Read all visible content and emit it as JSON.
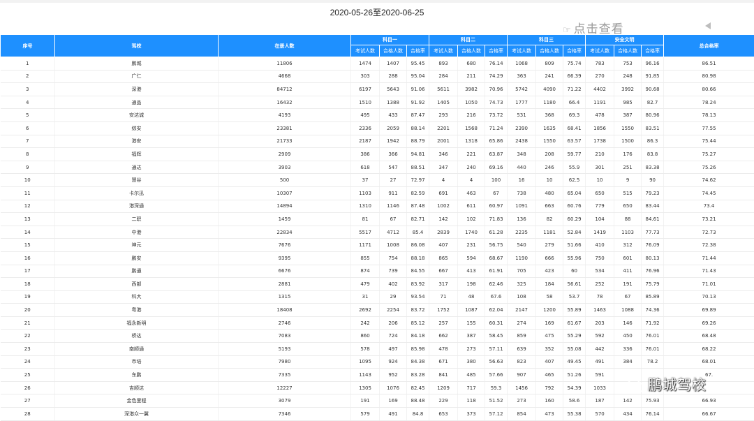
{
  "date_range": "2020-05-26至2020-06-25",
  "view_link": "点击查看",
  "watermark": "鹏城驾校",
  "headers": {
    "no": "序号",
    "school": "驾校",
    "enrolled": "在册人数",
    "subject1": "科目一",
    "subject2": "科目二",
    "subject3": "科目三",
    "safety": "安全文明",
    "total_rate": "总合格率",
    "examinees": "考试人数",
    "passed": "合格人数",
    "rate": "合格率"
  },
  "rows": [
    [
      "1",
      "鹏城",
      "11806",
      "1474",
      "1407",
      "95.45",
      "893",
      "680",
      "76.14",
      "1068",
      "809",
      "75.74",
      "783",
      "753",
      "96.16",
      "86.51"
    ],
    [
      "2",
      "广仁",
      "4668",
      "303",
      "288",
      "95.04",
      "284",
      "211",
      "74.29",
      "363",
      "241",
      "66.39",
      "270",
      "248",
      "91.85",
      "80.98"
    ],
    [
      "3",
      "深港",
      "84712",
      "6197",
      "5643",
      "91.06",
      "5611",
      "3982",
      "70.96",
      "5742",
      "4090",
      "71.22",
      "4402",
      "3992",
      "90.68",
      "80.66"
    ],
    [
      "4",
      "通品",
      "16432",
      "1510",
      "1388",
      "91.92",
      "1405",
      "1050",
      "74.73",
      "1777",
      "1180",
      "66.4",
      "1191",
      "985",
      "82.7",
      "78.24"
    ],
    [
      "5",
      "安达诚",
      "4193",
      "495",
      "433",
      "87.47",
      "293",
      "216",
      "73.72",
      "531",
      "368",
      "69.3",
      "478",
      "387",
      "80.96",
      "78.13"
    ],
    [
      "6",
      "综安",
      "23381",
      "2336",
      "2059",
      "88.14",
      "2201",
      "1568",
      "71.24",
      "2390",
      "1635",
      "68.41",
      "1856",
      "1550",
      "83.51",
      "77.55"
    ],
    [
      "7",
      "港安",
      "21733",
      "2187",
      "1942",
      "88.79",
      "2001",
      "1318",
      "65.86",
      "2438",
      "1550",
      "63.57",
      "1738",
      "1500",
      "86.3",
      "75.44"
    ],
    [
      "8",
      "福辉",
      "2909",
      "386",
      "366",
      "94.81",
      "346",
      "221",
      "63.87",
      "348",
      "208",
      "59.77",
      "210",
      "176",
      "83.8",
      "75.27"
    ],
    [
      "9",
      "通达",
      "3903",
      "618",
      "547",
      "88.51",
      "347",
      "240",
      "69.16",
      "440",
      "246",
      "55.9",
      "301",
      "251",
      "83.38",
      "75.26"
    ],
    [
      "10",
      "慧谷",
      "500",
      "37",
      "27",
      "72.97",
      "4",
      "4",
      "100",
      "16",
      "10",
      "62.5",
      "10",
      "9",
      "90",
      "74.62"
    ],
    [
      "11",
      "卡尔迅",
      "10307",
      "1103",
      "911",
      "82.59",
      "691",
      "463",
      "67",
      "738",
      "480",
      "65.04",
      "650",
      "515",
      "79.23",
      "74.45"
    ],
    [
      "12",
      "港深通",
      "14894",
      "1310",
      "1146",
      "87.48",
      "1002",
      "611",
      "60.97",
      "1091",
      "663",
      "60.76",
      "779",
      "650",
      "83.44",
      "73.4"
    ],
    [
      "13",
      "二职",
      "1459",
      "81",
      "67",
      "82.71",
      "142",
      "102",
      "71.83",
      "136",
      "82",
      "60.29",
      "104",
      "88",
      "84.61",
      "73.21"
    ],
    [
      "14",
      "中港",
      "22834",
      "5517",
      "4712",
      "85.4",
      "2839",
      "1740",
      "61.28",
      "2235",
      "1181",
      "52.84",
      "1419",
      "1103",
      "77.73",
      "72.73"
    ],
    [
      "15",
      "坤元",
      "7676",
      "1171",
      "1008",
      "86.08",
      "407",
      "231",
      "56.75",
      "540",
      "279",
      "51.66",
      "410",
      "312",
      "76.09",
      "72.38"
    ],
    [
      "16",
      "鹏安",
      "9395",
      "855",
      "754",
      "88.18",
      "865",
      "594",
      "68.67",
      "1190",
      "666",
      "55.96",
      "750",
      "601",
      "80.13",
      "71.44"
    ],
    [
      "17",
      "鹏通",
      "6676",
      "874",
      "739",
      "84.55",
      "667",
      "413",
      "61.91",
      "705",
      "423",
      "60",
      "534",
      "411",
      "76.96",
      "71.43"
    ],
    [
      "18",
      "西部",
      "2881",
      "479",
      "402",
      "83.92",
      "317",
      "198",
      "62.46",
      "325",
      "184",
      "56.61",
      "252",
      "191",
      "75.79",
      "71.01"
    ],
    [
      "19",
      "科大",
      "1315",
      "31",
      "29",
      "93.54",
      "71",
      "48",
      "67.6",
      "108",
      "58",
      "53.7",
      "78",
      "67",
      "85.89",
      "70.13"
    ],
    [
      "20",
      "粤港",
      "18408",
      "2692",
      "2254",
      "83.72",
      "1752",
      "1087",
      "62.04",
      "2147",
      "1200",
      "55.89",
      "1463",
      "1088",
      "74.36",
      "69.89"
    ],
    [
      "21",
      "福永新明",
      "2746",
      "242",
      "206",
      "85.12",
      "257",
      "155",
      "60.31",
      "274",
      "169",
      "61.67",
      "203",
      "146",
      "71.92",
      "69.26"
    ],
    [
      "22",
      "桥达",
      "7083",
      "860",
      "724",
      "84.18",
      "662",
      "387",
      "58.45",
      "859",
      "475",
      "55.29",
      "592",
      "450",
      "76.01",
      "68.48"
    ],
    [
      "23",
      "南顺通",
      "5193",
      "578",
      "497",
      "85.98",
      "478",
      "273",
      "57.11",
      "639",
      "352",
      "55.08",
      "442",
      "336",
      "76.01",
      "68.22"
    ],
    [
      "24",
      "市培",
      "7980",
      "1095",
      "924",
      "84.38",
      "671",
      "380",
      "56.63",
      "823",
      "407",
      "49.45",
      "491",
      "384",
      "78.2",
      "68.01"
    ],
    [
      "25",
      "东鹏",
      "7335",
      "1143",
      "952",
      "83.28",
      "841",
      "485",
      "57.66",
      "907",
      "465",
      "51.26",
      "591",
      "",
      "",
      "67."
    ],
    [
      "26",
      "吉顺达",
      "12227",
      "1305",
      "1076",
      "82.45",
      "1209",
      "717",
      "59.3",
      "1456",
      "792",
      "54.39",
      "1033",
      "",
      "",
      ""
    ],
    [
      "27",
      "金色里程",
      "3079",
      "191",
      "169",
      "88.48",
      "229",
      "118",
      "51.52",
      "273",
      "160",
      "58.6",
      "187",
      "142",
      "75.93",
      "66.93"
    ],
    [
      "28",
      "深港众一翼",
      "7346",
      "579",
      "491",
      "84.8",
      "653",
      "373",
      "57.12",
      "854",
      "473",
      "55.38",
      "570",
      "434",
      "76.14",
      "66.67"
    ]
  ]
}
